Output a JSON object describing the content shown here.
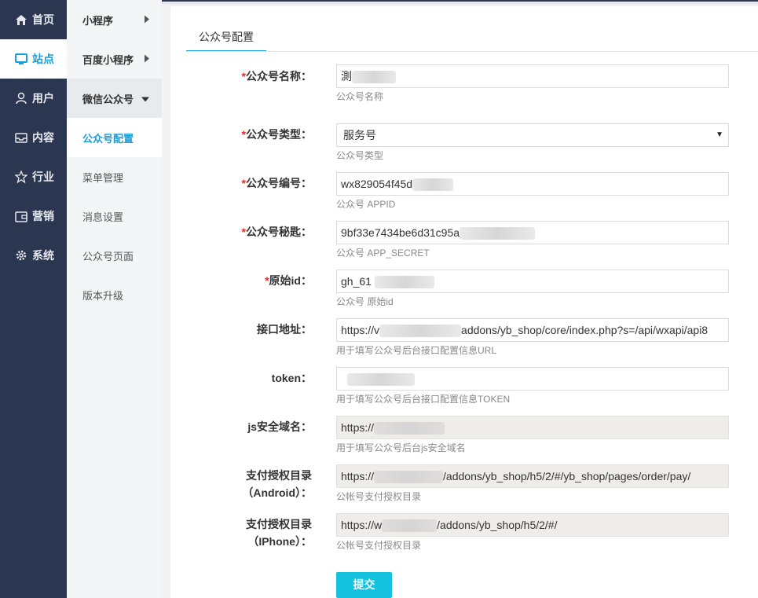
{
  "nav_primary": [
    {
      "label": "首页",
      "icon": "home-icon"
    },
    {
      "label": "站点",
      "icon": "monitor-icon"
    },
    {
      "label": "用户",
      "icon": "user-icon"
    },
    {
      "label": "内容",
      "icon": "inbox-icon"
    },
    {
      "label": "行业",
      "icon": "star-icon"
    },
    {
      "label": "营销",
      "icon": "wallet-icon"
    },
    {
      "label": "系统",
      "icon": "gear-icon"
    }
  ],
  "nav_secondary": [
    {
      "label": "小程序"
    },
    {
      "label": "百度小程序"
    },
    {
      "label": "微信公众号"
    },
    {
      "label": "公众号配置"
    },
    {
      "label": "菜单管理"
    },
    {
      "label": "消息设置"
    },
    {
      "label": "公众号页面"
    },
    {
      "label": "版本升级"
    }
  ],
  "tab": {
    "label": "公众号配置"
  },
  "form": {
    "name": {
      "required": "*",
      "label": "公众号名称：",
      "value": "測",
      "help": "公众号名称"
    },
    "type": {
      "required": "*",
      "label": "公众号类型：",
      "value": "服务号",
      "help": "公众号类型"
    },
    "appid": {
      "required": "*",
      "label": "公众号编号：",
      "value": "wx829054f45d",
      "help": "公众号 APPID"
    },
    "secret": {
      "required": "*",
      "label": "公众号秘匙：",
      "value": "9bf33e7434be6d31c95a",
      "help": "公众号 APP_SECRET"
    },
    "origid": {
      "required": "*",
      "label": "原始id：",
      "value": "gh_61",
      "help": "公众号 原始id"
    },
    "api_url": {
      "label": "接口地址：",
      "value_prefix": "https://v",
      "value_suffix": "addons/yb_shop/core/index.php?s=/api/wxapi/api8",
      "help": "用于填写公众号后台接口配置信息URL"
    },
    "token": {
      "label": "token：",
      "value": "",
      "help": "用于填写公众号后台接口配置信息TOKEN"
    },
    "js_domain": {
      "label": "js安全域名：",
      "value": "https://",
      "help": "用于填写公众号后台js安全域名"
    },
    "pay_android": {
      "label_line1": "支付授权目录",
      "label_line2": "（Android）：",
      "value_prefix": "https://",
      "value_suffix": "/addons/yb_shop/h5/2/#/yb_shop/pages/order/pay/",
      "help": "公帐号支付授权目录"
    },
    "pay_iphone": {
      "label_line1": "支付授权目录",
      "label_line2": "（IPhone）：",
      "value_prefix": "https://w",
      "value_suffix": "/addons/yb_shop/h5/2/#/",
      "help": "公帐号支付授权目录"
    }
  },
  "submit": {
    "label": "提交"
  },
  "colors": {
    "accent": "#1a9ed9",
    "sidebar": "#2b3650",
    "button": "#14c2e0",
    "required": "#d9302b"
  }
}
